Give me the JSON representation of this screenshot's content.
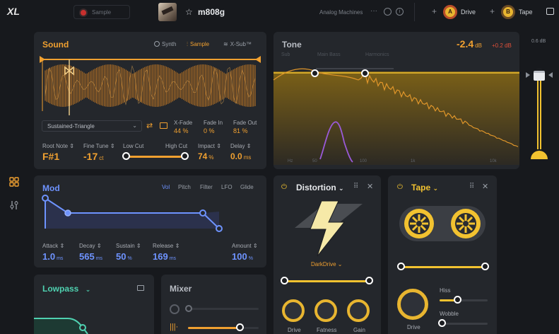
{
  "logo": "XL",
  "topbar": {
    "sample_tab": "Sample",
    "preset_name": "m808g",
    "library": "Analog Machines",
    "fx_a_badge": "A",
    "fx_a_label": "Drive",
    "fx_b_badge": "B",
    "fx_b_label": "Tape"
  },
  "sound": {
    "title": "Sound",
    "modes": [
      "Synth",
      "Sample",
      "X-Sub™"
    ],
    "wave_select": "Sustained-Triangle",
    "xfade_label": "X-Fade",
    "xfade_value": "44 %",
    "fadein_label": "Fade In",
    "fadein_value": "0 %",
    "fadeout_label": "Fade Out",
    "fadeout_value": "81 %",
    "root_label": "Root Note",
    "root_value": "F#1",
    "fine_label": "Fine Tune",
    "fine_value": "-17",
    "fine_unit": "ct",
    "lowcut_label": "Low Cut",
    "highcut_label": "High Cut",
    "impact_label": "Impact",
    "impact_value": "74",
    "impact_unit": "%",
    "delay_label": "Delay",
    "delay_value": "0.0",
    "delay_unit": "ms"
  },
  "tone": {
    "title": "Tone",
    "gain_value": "-2.4",
    "gain_unit": "dB",
    "gain_delta": "+0.2 dB",
    "bands": [
      "Sub",
      "Main Bass",
      "Harmonics"
    ],
    "freq_labels": [
      "Hz",
      "50",
      "100",
      "1k",
      "10k"
    ],
    "meter_label": "0.6 dB"
  },
  "mod": {
    "title": "Mod",
    "tabs": [
      "Vol",
      "Pitch",
      "Filter",
      "LFO",
      "Glide"
    ],
    "attack_label": "Attack",
    "attack_value": "1.0",
    "attack_unit": "ms",
    "decay_label": "Decay",
    "decay_value": "565",
    "decay_unit": "ms",
    "sustain_label": "Sustain",
    "sustain_value": "50",
    "sustain_unit": "%",
    "release_label": "Release",
    "release_value": "169",
    "release_unit": "ms",
    "amount_label": "Amount",
    "amount_value": "100",
    "amount_unit": "%"
  },
  "distortion": {
    "title": "Distortion",
    "preset": "DarkDrive",
    "knobs": [
      "Drive",
      "Fatness",
      "Gain"
    ]
  },
  "tape": {
    "title": "Tape",
    "drive_label": "Drive",
    "hiss_label": "Hiss",
    "wobble_label": "Wobble"
  },
  "lowpass": {
    "title": "Lowpass"
  },
  "mixer": {
    "title": "Mixer"
  }
}
